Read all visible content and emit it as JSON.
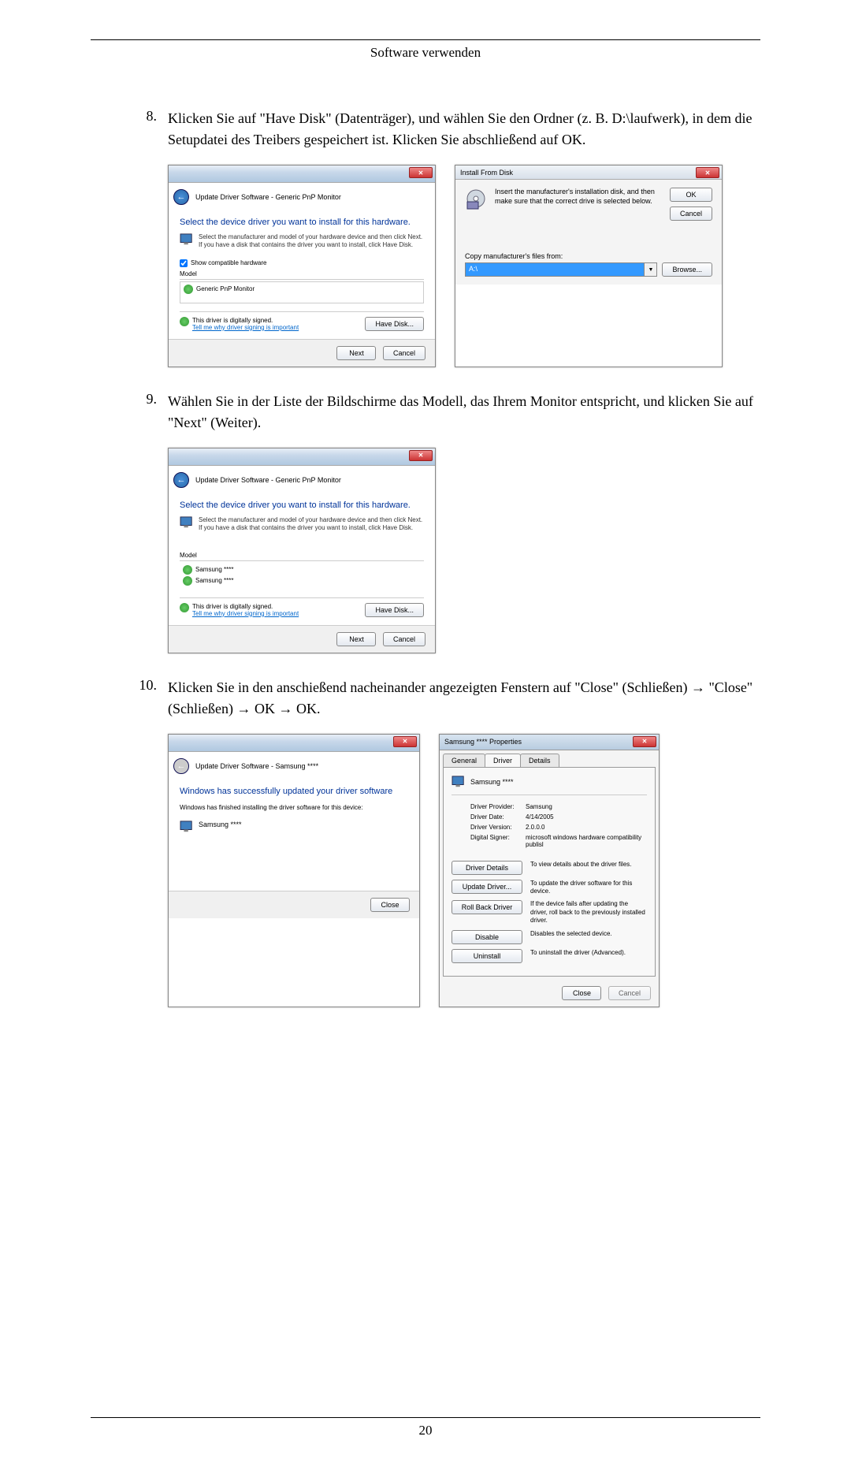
{
  "page": {
    "header": "Software verwenden",
    "number": "20"
  },
  "step8": {
    "num": "8.",
    "text": "Klicken Sie auf \"Have Disk\" (Datenträger), und wählen Sie den Ordner (z. B. D:\\laufwerk), in dem die Setupdatei des Treibers gespeichert ist. Klicken Sie abschließend auf OK."
  },
  "step9": {
    "num": "9.",
    "text": "Wählen Sie in der Liste der Bildschirme das Modell, das Ihrem Monitor entspricht, und klicken Sie auf \"Next\" (Weiter)."
  },
  "step10": {
    "num": "10.",
    "text": "Klicken Sie in den anschießend nacheinander angezeigten Fenstern auf \"Close\" (Schließen) → \"Close\" (Schließen) → OK → OK."
  },
  "dlgDriver1": {
    "breadcrumb": "Update Driver Software - Generic PnP Monitor",
    "heading": "Select the device driver you want to install for this hardware.",
    "subtext": "Select the manufacturer and model of your hardware device and then click Next. If you have a disk that contains the driver you want to install, click Have Disk.",
    "showCompat": "Show compatible hardware",
    "modelHeader": "Model",
    "model1": "Generic PnP Monitor",
    "signed": "This driver is digitally signed.",
    "signLink": "Tell me why driver signing is important",
    "haveDisk": "Have Disk...",
    "next": "Next",
    "cancel": "Cancel"
  },
  "dlgInstallDisk": {
    "title": "Install From Disk",
    "text": "Insert the manufacturer's installation disk, and then make sure that the correct drive is selected below.",
    "ok": "OK",
    "cancel": "Cancel",
    "copyLabel": "Copy manufacturer's files from:",
    "path": "A:\\",
    "browse": "Browse..."
  },
  "dlgDriver2": {
    "breadcrumb": "Update Driver Software - Generic PnP Monitor",
    "heading": "Select the device driver you want to install for this hardware.",
    "subtext": "Select the manufacturer and model of your hardware device and then click Next. If you have a disk that contains the driver you want to install, click Have Disk.",
    "modelHeader": "Model",
    "model1": "Samsung ****",
    "model2": "Samsung ****",
    "signed": "This driver is digitally signed.",
    "signLink": "Tell me why driver signing is important",
    "haveDisk": "Have Disk...",
    "next": "Next",
    "cancel": "Cancel"
  },
  "dlgSuccess": {
    "breadcrumb": "Update Driver Software - Samsung ****",
    "heading": "Windows has successfully updated your driver software",
    "subtext": "Windows has finished installing the driver software for this device:",
    "device": "Samsung ****",
    "close": "Close"
  },
  "dlgProps": {
    "title": "Samsung **** Properties",
    "tabGeneral": "General",
    "tabDriver": "Driver",
    "tabDetails": "Details",
    "device": "Samsung ****",
    "providerLabel": "Driver Provider:",
    "providerValue": "Samsung",
    "dateLabel": "Driver Date:",
    "dateValue": "4/14/2005",
    "versionLabel": "Driver Version:",
    "versionValue": "2.0.0.0",
    "signerLabel": "Digital Signer:",
    "signerValue": "microsoft windows hardware compatibility publisl",
    "btnDetails": "Driver Details",
    "descDetails": "To view details about the driver files.",
    "btnUpdate": "Update Driver...",
    "descUpdate": "To update the driver software for this device.",
    "btnRollback": "Roll Back Driver",
    "descRollback": "If the device fails after updating the driver, roll back to the previously installed driver.",
    "btnDisable": "Disable",
    "descDisable": "Disables the selected device.",
    "btnUninstall": "Uninstall",
    "descUninstall": "To uninstall the driver (Advanced).",
    "close": "Close",
    "cancel": "Cancel"
  }
}
